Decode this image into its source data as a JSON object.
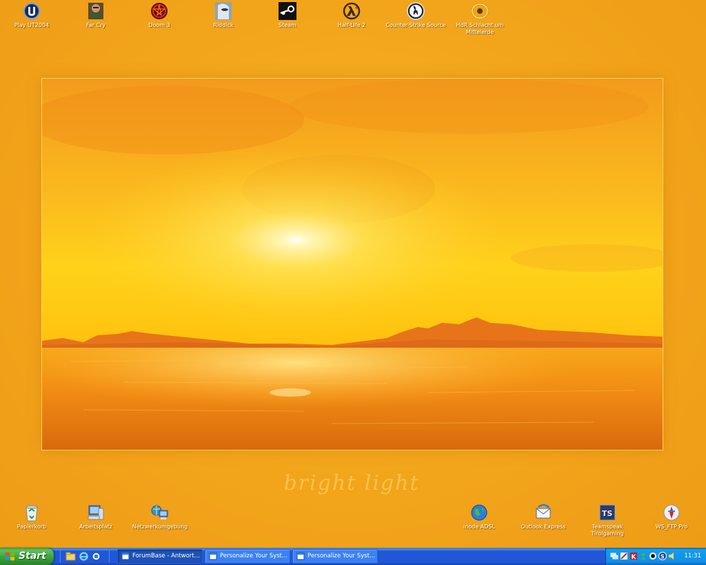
{
  "desktop": {
    "top_icons": [
      {
        "label": "Play UT2004",
        "icon": "unreal-icon"
      },
      {
        "label": "Far Cry",
        "icon": "far-cry-icon"
      },
      {
        "label": "Doom 3",
        "icon": "doom3-icon"
      },
      {
        "label": "Riddick",
        "icon": "riddick-icon"
      },
      {
        "label": "Steam",
        "icon": "steam-icon"
      },
      {
        "label": "Half-Life 2",
        "icon": "half-life-icon"
      },
      {
        "label": "Counter-Strike Source",
        "icon": "counter-strike-icon"
      },
      {
        "label": "HdR Schlacht um Mittelerde",
        "icon": "ring-icon"
      }
    ],
    "bottom_icons": [
      {
        "label": "Papierkorb",
        "icon": "recycle-bin-icon"
      },
      {
        "label": "Arbeitsplatz",
        "icon": "my-computer-icon"
      },
      {
        "label": "Netzwerkumgebung",
        "icon": "network-icon"
      },
      {
        "label": "inode ADSL",
        "icon": "globe-icon"
      },
      {
        "label": "Outlook Express",
        "icon": "outlook-express-icon"
      },
      {
        "label": "Teamspeak Tirolgaming",
        "icon": "teamspeak-icon"
      },
      {
        "label": "WS_FTP Pro",
        "icon": "ftp-icon"
      }
    ],
    "wallpaper_text": "bright light"
  },
  "taskbar": {
    "start_label": "Start",
    "tasks": [
      {
        "label": "ForumBase - Antwort...",
        "active": true
      },
      {
        "label": "Personalize Your Syst...",
        "active": false
      },
      {
        "label": "Personalize Your Syst...",
        "active": false
      }
    ],
    "clock": "11:31"
  },
  "colors": {
    "desktop_orange": "#f2a51b",
    "taskbar_blue": "#2157d7",
    "start_green": "#37a037",
    "tray_blue": "#1290e8"
  }
}
